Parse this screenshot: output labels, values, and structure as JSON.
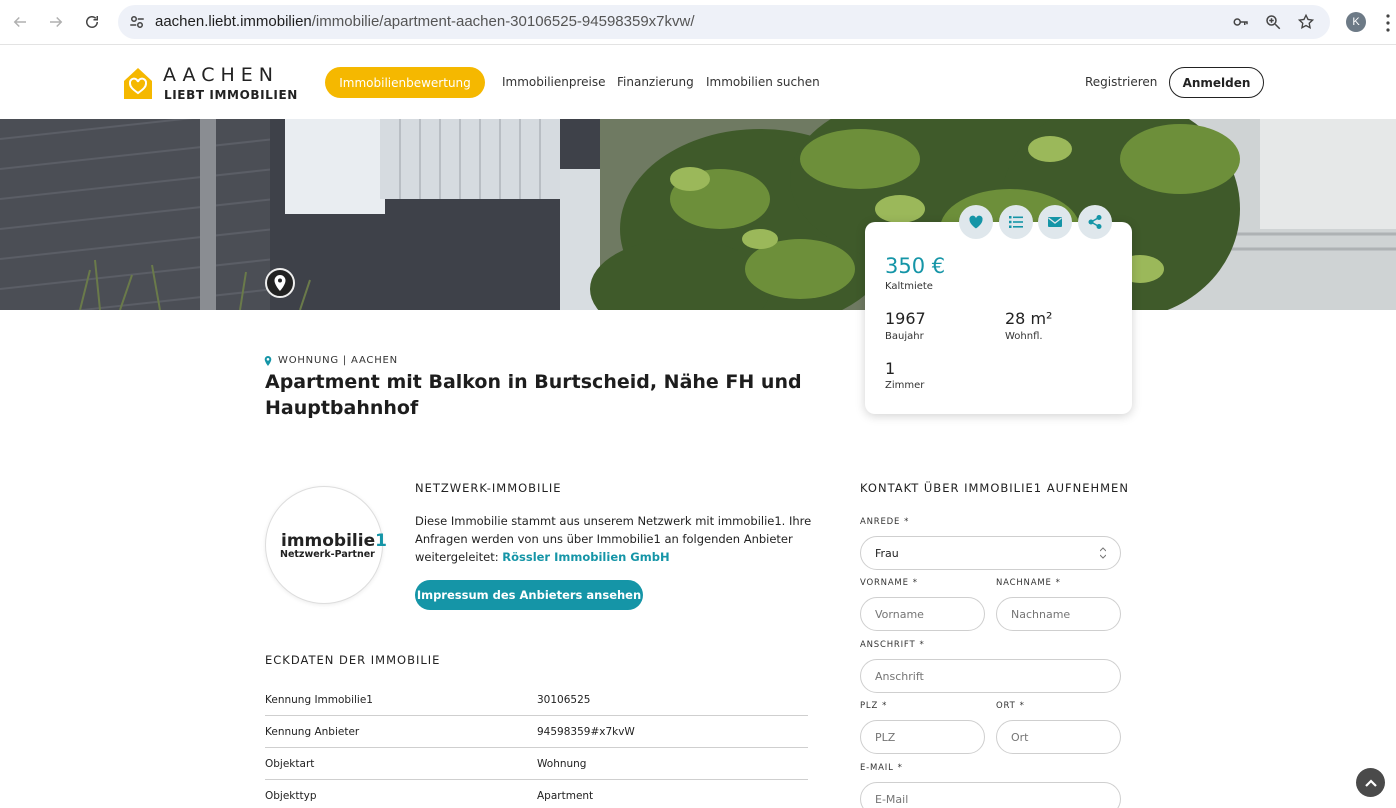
{
  "browser": {
    "url_host": "aachen.liebt.immobilien",
    "url_path": "/immobilie/apartment-aachen-30106525-94598359x7kvw/",
    "profile_initial": "K"
  },
  "header": {
    "logo_top": "AACHEN",
    "logo_bottom": "LIEBT IMMOBILIEN",
    "cta": "Immobilienbewertung",
    "nav": [
      "Immobilienpreise",
      "Finanzierung",
      "Immobilien suchen"
    ],
    "register": "Registrieren",
    "login": "Anmelden"
  },
  "card": {
    "price": "350 €",
    "price_label": "Kaltmiete",
    "year": "1967",
    "year_label": "Baujahr",
    "area": "28 m²",
    "area_label": "Wohnfl.",
    "rooms": "1",
    "rooms_label": "Zimmer",
    "actions": [
      "heart-icon",
      "list-icon",
      "envelope-icon",
      "share-icon"
    ]
  },
  "listing": {
    "kicker": "WOHNUNG | AACHEN",
    "title": "Apartment mit Balkon in Burtscheid, Nähe FH und Hauptbahnhof"
  },
  "network": {
    "heading": "NETZWERK-IMMOBILIE",
    "logo_name": "immobilie",
    "logo_one": "1",
    "logo_sub": "Netzwerk-Partner",
    "text": "Diese Immobilie stammt aus unserem Netzwerk mit immobilie1. Ihre Anfragen werden von uns über Immobilie1 an folgenden Anbieter weitergeleitet: ",
    "provider": "Rössler Immobilien GmbH",
    "button": "Impressum des Anbieters ansehen"
  },
  "facts": {
    "heading": "ECKDATEN DER IMMOBILIE",
    "rows": [
      {
        "key": "Kennung Immobilie1",
        "value": "30106525"
      },
      {
        "key": "Kennung Anbieter",
        "value": "94598359#x7kvW"
      },
      {
        "key": "Objektart",
        "value": "Wohnung"
      },
      {
        "key": "Objekttyp",
        "value": "Apartment"
      }
    ]
  },
  "contact": {
    "heading": "KONTAKT ÜBER IMMOBILIE1 AUFNEHMEN",
    "required_mark": "*",
    "anrede_label": "ANREDE",
    "anrede_value": "Frau",
    "vorname_label": "VORNAME",
    "vorname_placeholder": "Vorname",
    "nachname_label": "NACHNAME",
    "nachname_placeholder": "Nachname",
    "anschrift_label": "ANSCHRIFT",
    "anschrift_placeholder": "Anschrift",
    "plz_label": "PLZ",
    "plz_placeholder": "PLZ",
    "ort_label": "ORT",
    "ort_placeholder": "Ort",
    "email_label": "E-MAIL",
    "email_placeholder": "E-Mail"
  },
  "colors": {
    "accent": "#1595a7",
    "brand_yellow": "#f5b800"
  }
}
